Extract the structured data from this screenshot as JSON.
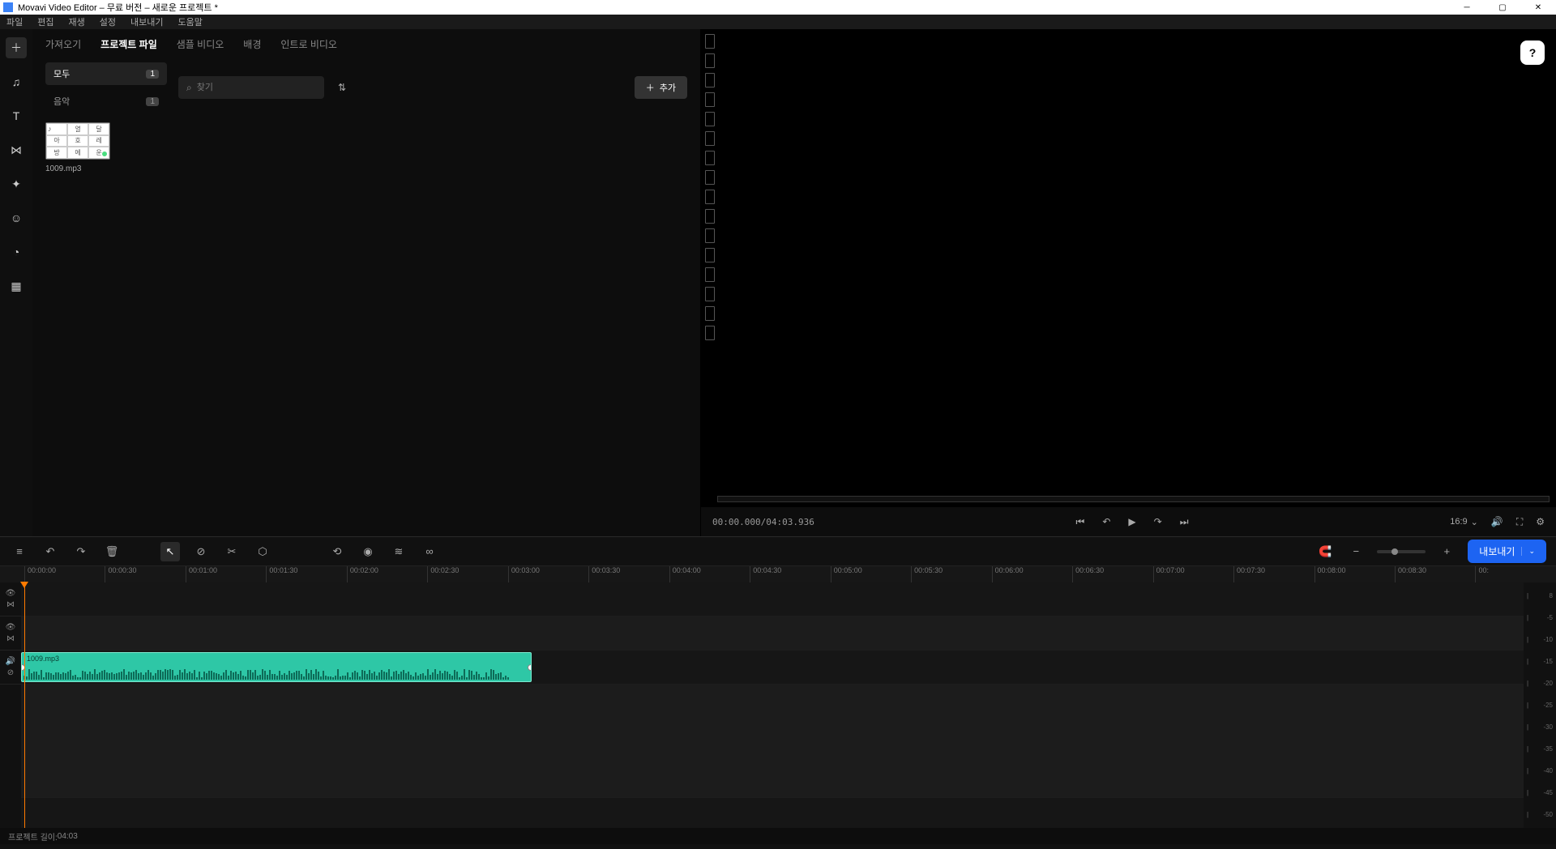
{
  "title": "Movavi Video Editor – 무료 버전 – 새로운 프로젝트 *",
  "menubar": [
    "파일",
    "편집",
    "재생",
    "설정",
    "내보내기",
    "도움말"
  ],
  "lib_tabs": [
    "가져오기",
    "프로젝트 파일",
    "샘플 비디오",
    "배경",
    "인트로 비디오"
  ],
  "lib_tab_active": 1,
  "categories": [
    {
      "label": "모두",
      "count": "1",
      "active": true
    },
    {
      "label": "음악",
      "count": "1",
      "active": false
    }
  ],
  "search_placeholder": "찾기",
  "add_button": "추가",
  "thumbnail": {
    "name": "1009.mp3",
    "cells": [
      "열",
      "달",
      "아",
      "호",
      "레",
      "방",
      "에",
      "운"
    ]
  },
  "timecode": "00:00.000/04:03.936",
  "aspect_ratio": "16:9",
  "ruler_ticks": [
    "00:00:00",
    "00:00:30",
    "00:01:00",
    "00:01:30",
    "00:02:00",
    "00:02:30",
    "00:03:00",
    "00:03:30",
    "00:04:00",
    "00:04:30",
    "00:05:00",
    "00:05:30",
    "00:06:00",
    "00:06:30",
    "00:07:00",
    "00:07:30",
    "00:08:00",
    "00:08:30",
    "00:"
  ],
  "clip_name": "1009.mp3",
  "export_label": "내보내기",
  "project_length_label": "프로젝트 길이:",
  "project_length_value": "04:03",
  "vu_levels": [
    "8",
    "-5",
    "-10",
    "-15",
    "-20",
    "-25",
    "-30",
    "-35",
    "-40",
    "-45",
    "-50"
  ],
  "help_icon": "?"
}
